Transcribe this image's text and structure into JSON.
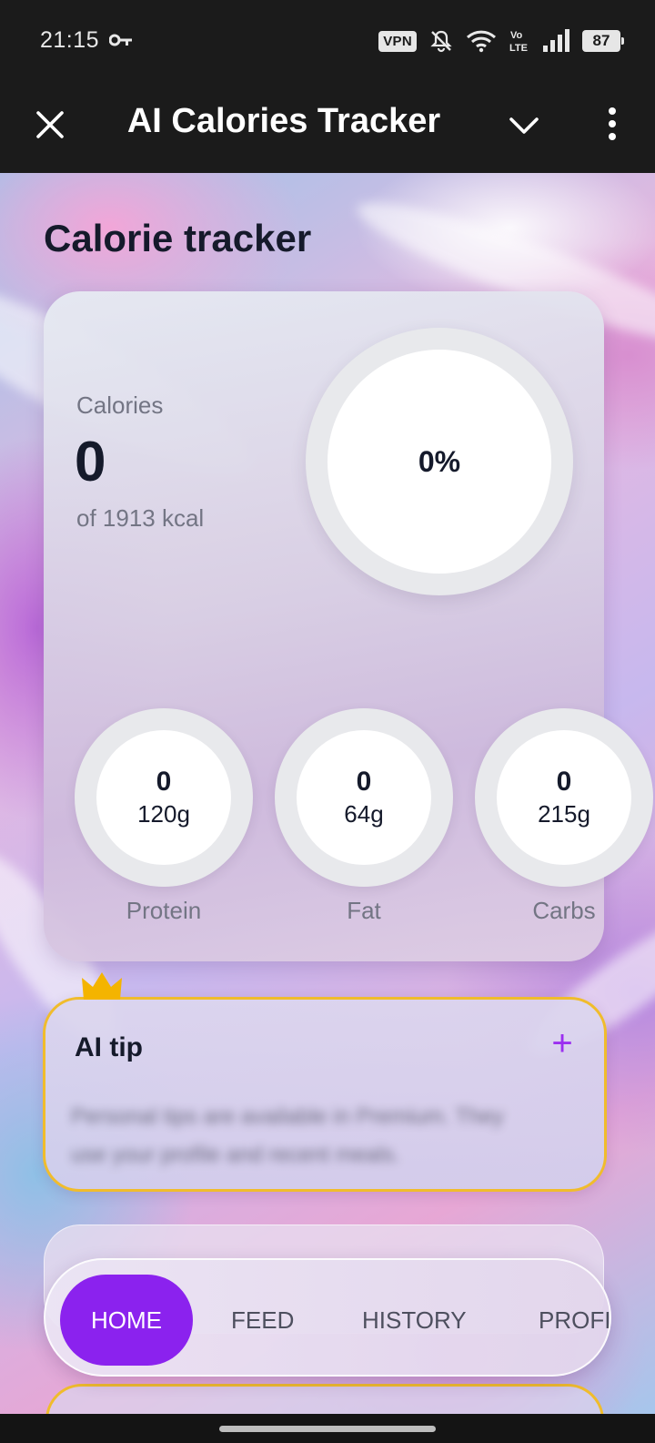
{
  "status_bar": {
    "time": "21:15",
    "vpn": "VPN",
    "battery": "87",
    "icons": [
      "key-icon",
      "vpn-icon",
      "mute-icon",
      "wifi-icon",
      "volte-icon",
      "signal-icon",
      "battery-icon"
    ]
  },
  "toolbar": {
    "title": "AI Calories Tracker",
    "icons": [
      "close-icon",
      "chevron-down-icon",
      "more-vert-icon"
    ]
  },
  "page": {
    "title": "Calorie tracker"
  },
  "calories": {
    "label": "Calories",
    "value": "0",
    "goal_text": "of 1913 kcal",
    "percent_text": "0%",
    "progress_fraction": 0
  },
  "macros": [
    {
      "label": "Protein",
      "value": "0",
      "goal": "120g",
      "progress_fraction": 0
    },
    {
      "label": "Fat",
      "value": "0",
      "goal": "64g",
      "progress_fraction": 0
    },
    {
      "label": "Carbs",
      "value": "0",
      "goal": "215g",
      "progress_fraction": 0
    }
  ],
  "ai_tip": {
    "title": "AI tip",
    "add_icon": "plus-icon",
    "badge_icon": "crown-icon",
    "body": "Personal tips are available in Premium. They use your profile and recent meals."
  },
  "bottom_nav": {
    "items": [
      "HOME",
      "FEED",
      "HISTORY",
      "PROFI"
    ],
    "active": "HOME"
  },
  "colors": {
    "accent": "#8b22ee",
    "premium_border": "#f0bc2c",
    "text_primary": "#151a2b",
    "text_secondary": "#737584",
    "bar_background": "#1b1b1b"
  }
}
